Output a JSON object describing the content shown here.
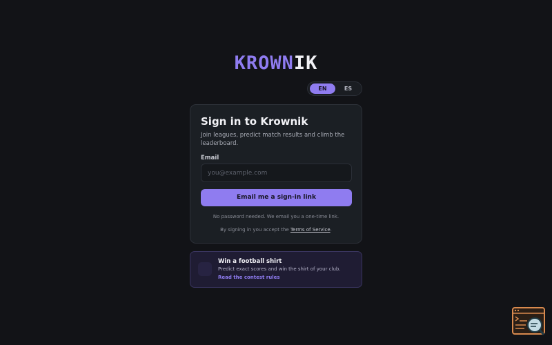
{
  "brand": {
    "part1": "KROWN",
    "part2": "IK"
  },
  "language": {
    "options": [
      "EN",
      "ES"
    ],
    "selected": "EN"
  },
  "signin": {
    "title": "Sign in to Krownik",
    "subtitle": "Join leagues, predict match results and climb the leaderboard.",
    "email_label": "Email",
    "email_placeholder": "you@example.com",
    "email_value": "",
    "submit_label": "Email me a sign-in link",
    "note": "No password needed. We email you a one-time link.",
    "terms_prefix": "By signing in you accept the ",
    "terms_link": "Terms of Service",
    "terms_suffix": "."
  },
  "promo": {
    "title": "Win a football shirt",
    "text": "Predict exact scores and win the shirt of your club.",
    "link": "Read the contest rules"
  },
  "colors": {
    "accent": "#8f7cf0",
    "background": "#121317",
    "card": "#1b1f24",
    "promo_bg": "#1f1c33"
  },
  "icons": {
    "promo": "shirt-icon",
    "helper": "feedback-widget-icon"
  }
}
